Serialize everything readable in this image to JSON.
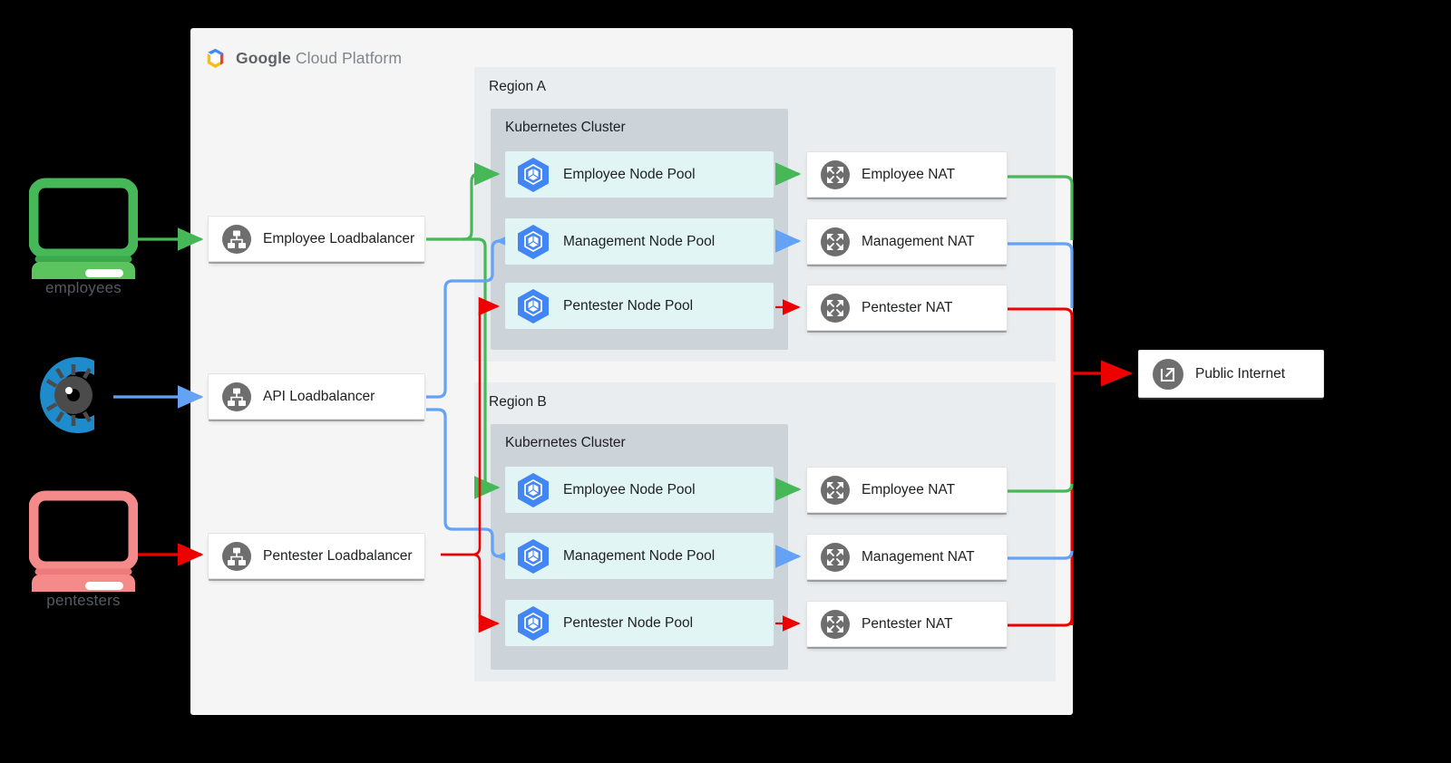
{
  "header": {
    "brand_bold": "Google",
    "brand_light": " Cloud Platform",
    "logo_icon": "google-cloud-logo"
  },
  "colors": {
    "employee_flow": "#46B857",
    "management_flow": "#64A2F5",
    "pentester_flow": "#EE0000",
    "panel_bg": "#F5F5F5",
    "region_bg": "#E9EDF0",
    "cluster_bg": "#CCD3D9",
    "pool_bg": "#E1F5F5",
    "node_bg": "#FFFFFF",
    "k8s_blue": "#4285F4",
    "icon_gray": "#5F6368",
    "text": "#202124"
  },
  "endpoints": [
    {
      "id": "employees",
      "caption": "employees",
      "icon": "desktop-computer-icon",
      "color": "#46B857"
    },
    {
      "id": "api",
      "caption": "",
      "icon": "api-gear-icon",
      "color": "#1E8BCD"
    },
    {
      "id": "pentesters",
      "caption": "pentesters",
      "icon": "desktop-computer-icon",
      "color": "#F58A8A"
    }
  ],
  "loadbalancers": [
    {
      "id": "employee",
      "label": "Employee Loadbalancer",
      "icon": "loadbalancer-icon"
    },
    {
      "id": "api",
      "label": "API Loadbalancer",
      "icon": "loadbalancer-icon"
    },
    {
      "id": "pentester",
      "label": "Pentester Loadbalancer",
      "icon": "loadbalancer-icon"
    }
  ],
  "regions": [
    {
      "id": "region-a",
      "label": "Region A",
      "cluster": {
        "label": "Kubernetes Cluster",
        "node_pools": [
          {
            "id": "employee",
            "label": "Employee Node Pool",
            "icon": "kubernetes-icon"
          },
          {
            "id": "management",
            "label": "Management Node Pool",
            "icon": "kubernetes-icon"
          },
          {
            "id": "pentester",
            "label": "Pentester Node Pool",
            "icon": "kubernetes-icon"
          }
        ]
      },
      "nats": [
        {
          "id": "employee",
          "label": "Employee NAT",
          "icon": "nat-expand-icon"
        },
        {
          "id": "management",
          "label": "Management NAT",
          "icon": "nat-expand-icon"
        },
        {
          "id": "pentester",
          "label": "Pentester NAT",
          "icon": "nat-expand-icon"
        }
      ]
    },
    {
      "id": "region-b",
      "label": "Region B",
      "cluster": {
        "label": "Kubernetes Cluster",
        "node_pools": [
          {
            "id": "employee",
            "label": "Employee Node Pool",
            "icon": "kubernetes-icon"
          },
          {
            "id": "management",
            "label": "Management Node Pool",
            "icon": "kubernetes-icon"
          },
          {
            "id": "pentester",
            "label": "Pentester Node Pool",
            "icon": "kubernetes-icon"
          }
        ]
      },
      "nats": [
        {
          "id": "employee",
          "label": "Employee NAT",
          "icon": "nat-expand-icon"
        },
        {
          "id": "management",
          "label": "Management NAT",
          "icon": "nat-expand-icon"
        },
        {
          "id": "pentester",
          "label": "Pentester NAT",
          "icon": "nat-expand-icon"
        }
      ]
    }
  ],
  "internet": {
    "label": "Public Internet",
    "icon": "external-link-icon"
  }
}
